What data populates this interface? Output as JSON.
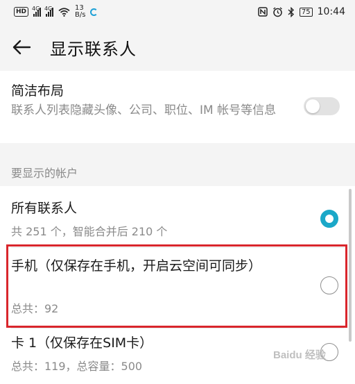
{
  "status_bar": {
    "hd": "HD",
    "signal1_label": "4G",
    "signal2_label": "4G",
    "speed_value": "13",
    "speed_unit": "B/s",
    "battery": "75",
    "time": "10:44",
    "icons": [
      "hd-icon",
      "signal-icon",
      "signal-icon",
      "wifi-icon",
      "spinner-icon",
      "nfc-icon",
      "alarm-icon",
      "bluetooth-icon",
      "battery-icon"
    ]
  },
  "app_bar": {
    "title": "显示联系人",
    "back_icon": "arrow-left-icon"
  },
  "simple_layout": {
    "title": "简洁布局",
    "description": "联系人列表隐藏头像、公司、职位、IM 帐号等信息",
    "enabled": false
  },
  "accounts_section": {
    "label": "要显示的帐户",
    "items": [
      {
        "title": "所有联系人",
        "subtitle": "共 251 个，智能合并后 210 个",
        "selected": true
      },
      {
        "title": "手机（仅保存在手机，开启云空间可同步）",
        "subtitle": "总共：92",
        "selected": false
      },
      {
        "title": "卡 1（仅保存在SIM卡）",
        "subtitle": "总共：119，总容量：500",
        "selected": false
      }
    ]
  },
  "watermark": "Baidu 经验",
  "colors": {
    "accent": "#1ba8c8",
    "highlight": "#d9262c",
    "background": "#f4f4f4",
    "card": "#ffffff",
    "secondary_text": "#8a8a8a"
  }
}
